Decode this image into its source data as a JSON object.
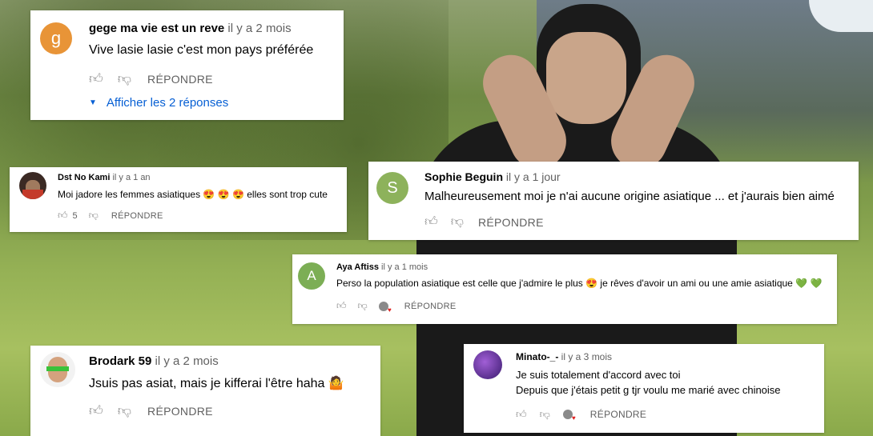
{
  "colors": {
    "avatar_g": "#e89437",
    "avatar_s": "#8db25b",
    "avatar_a": "#7cae55",
    "link": "#065fd4"
  },
  "comments": [
    {
      "author": "gege ma vie est un reve",
      "time": "il y a 2 mois",
      "avatar_letter": "g",
      "text": "Vive lasie lasie c'est mon pays préférée",
      "reply": "RÉPONDRE",
      "toggle": "Afficher les 2 réponses"
    },
    {
      "author": "Dst No Kami",
      "time": "il y a 1 an",
      "text": "Moi jadore les femmes asiatiques 😍 😍 😍  elles sont trop cute",
      "likes": "5",
      "reply": "RÉPONDRE"
    },
    {
      "author": "Sophie Beguin",
      "time": "il y a 1 jour",
      "avatar_letter": "S",
      "text": "Malheureusement moi je n'ai aucune origine asiatique ... et j'aurais bien aimé",
      "reply": "RÉPONDRE"
    },
    {
      "author": "Aya Aftiss",
      "time": "il y a 1 mois",
      "avatar_letter": "A",
      "text": "Perso la population asiatique est celle que j'admire le plus 😍  je rêves d'avoir un ami ou une amie asiatique 💚 💚",
      "reply": "RÉPONDRE"
    },
    {
      "author": "Brodark 59",
      "time": "il y a 2 mois",
      "text": "Jsuis pas asiat, mais je kifferai l'être haha 🤷",
      "reply": "RÉPONDRE"
    },
    {
      "author": "Minato-_-",
      "time": "il y a 3 mois",
      "text_line1": "Je suis totalement d'accord avec toi",
      "text_line2": "Depuis que j'étais petit g tjr voulu me marié avec chinoise",
      "reply": "RÉPONDRE"
    }
  ],
  "icons": {
    "like": "thumbs-up-icon",
    "dislike": "thumbs-down-icon",
    "creator_heart": "creator-heart-icon",
    "expand": "caret-down-icon"
  }
}
